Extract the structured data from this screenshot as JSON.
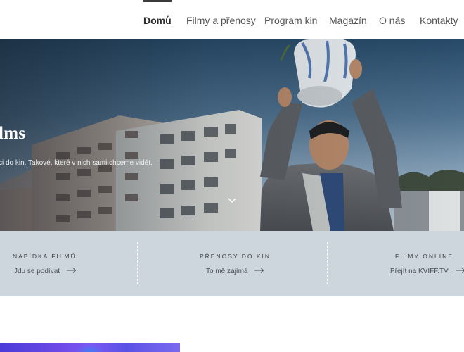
{
  "nav": {
    "items": [
      {
        "label": "Domů",
        "active": true
      },
      {
        "label": "Filmy a přenosy",
        "active": false
      },
      {
        "label": "Program kin",
        "active": false
      },
      {
        "label": "Magazín",
        "active": false
      },
      {
        "label": "O nás",
        "active": false
      },
      {
        "label": "Kontakty",
        "active": false
      }
    ]
  },
  "hero": {
    "title": "lms",
    "subtitle": "ci do kin. Takové, které v nich sami chceme vidět.",
    "scroll_icon": "chevron-down-icon"
  },
  "sections": [
    {
      "heading": "NABÍDKA FILMŮ",
      "link": "Jdu se podívat",
      "icon": "arrow-right-icon"
    },
    {
      "heading": "PŘENOSY DO KIN",
      "link": "To mě zajímá",
      "icon": "arrow-right-icon"
    },
    {
      "heading": "FILMY ONLINE",
      "link": "Přejít na KVIFF.TV",
      "icon": "arrow-right-icon"
    }
  ],
  "colors": {
    "section_bg": "#cdd6dd",
    "nav_active": "#3a3a3a",
    "promo_accent": "#6f4be8"
  }
}
